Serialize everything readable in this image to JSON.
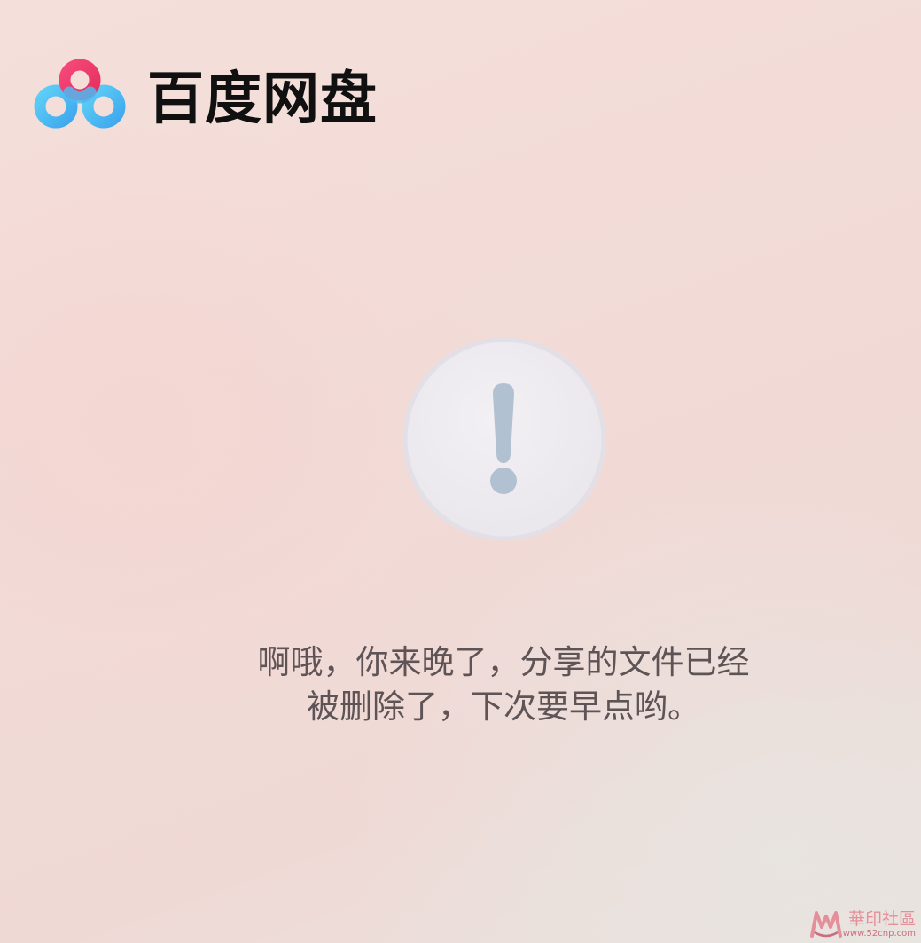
{
  "app": {
    "title": "百度网盘",
    "logo_icon": "baidu-netdisk-logo-icon"
  },
  "alert": {
    "icon": "exclamation-icon",
    "message_lines": [
      "啊哦，你来晚了，分享的文件已经",
      "被删除了，下次要早点哟。"
    ]
  },
  "watermark": {
    "title": "華印社區",
    "url": "www.52cnp.com"
  },
  "colors": {
    "logo_blue": "#3fc0f0",
    "logo_pink": "#f2406e",
    "alert_circle": "#ecebef",
    "alert_icon": "#b1c1d1",
    "text": "#5e5456"
  }
}
